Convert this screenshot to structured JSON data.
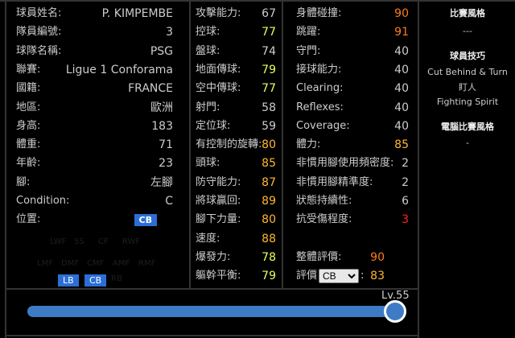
{
  "info": [
    {
      "label": "球員姓名:",
      "value": "P. KIMPEMBE"
    },
    {
      "label": "隊員編號:",
      "value": "3"
    },
    {
      "label": "球隊名稱:",
      "value": "PSG"
    },
    {
      "label": "聯賽:",
      "value": "Ligue 1 Conforama"
    },
    {
      "label": "國籍:",
      "value": "FRANCE"
    },
    {
      "label": "地區:",
      "value": "歐洲"
    },
    {
      "label": "身高:",
      "value": "183"
    },
    {
      "label": "體重:",
      "value": "71"
    },
    {
      "label": "年齡:",
      "value": "23"
    },
    {
      "label": "腳:",
      "value": "左腳"
    },
    {
      "label": "Condition:",
      "value": "C"
    },
    {
      "label": "位置:",
      "value": "CB"
    }
  ],
  "positions": {
    "row1": [
      "LWF",
      "SS",
      "CF",
      "RWF"
    ],
    "row2": [
      "LMF",
      "DMF",
      "CMF",
      "AMF",
      "RMF"
    ],
    "row3": [
      "LB",
      "CB",
      "RB"
    ]
  },
  "stats1": [
    {
      "label": "攻擊能力:",
      "value": "67",
      "color": "#cccccc"
    },
    {
      "label": "控球:",
      "value": "77",
      "color": "#e8ff5a"
    },
    {
      "label": "盤球:",
      "value": "74",
      "color": "#cccccc"
    },
    {
      "label": "地面傳球:",
      "value": "79",
      "color": "#e8ff5a"
    },
    {
      "label": "空中傳球:",
      "value": "77",
      "color": "#e8ff5a"
    },
    {
      "label": "射門:",
      "value": "58",
      "color": "#cccccc"
    },
    {
      "label": "定位球:",
      "value": "59",
      "color": "#cccccc"
    },
    {
      "label": "有控制的旋轉:",
      "value": "80",
      "color": "#ffb733"
    },
    {
      "label": "頭球:",
      "value": "85",
      "color": "#ffb733"
    },
    {
      "label": "防守能力:",
      "value": "87",
      "color": "#ffb733"
    },
    {
      "label": "將球贏回:",
      "value": "89",
      "color": "#ffb733"
    },
    {
      "label": "腳下力量:",
      "value": "80",
      "color": "#ffb733"
    },
    {
      "label": "速度:",
      "value": "88",
      "color": "#ffb733"
    },
    {
      "label": "爆發力:",
      "value": "78",
      "color": "#e8ff5a"
    },
    {
      "label": "軀幹平衡:",
      "value": "79",
      "color": "#e8ff5a"
    }
  ],
  "stats2": [
    {
      "label": "身體碰撞:",
      "value": "90",
      "color": "#ff7a1a"
    },
    {
      "label": "跳躍:",
      "value": "91",
      "color": "#ff7a1a"
    },
    {
      "label": "守門:",
      "value": "40",
      "color": "#cccccc"
    },
    {
      "label": "接球能力:",
      "value": "40",
      "color": "#cccccc"
    },
    {
      "label": "Clearing:",
      "value": "40",
      "color": "#cccccc"
    },
    {
      "label": "Reflexes:",
      "value": "40",
      "color": "#cccccc"
    },
    {
      "label": "Coverage:",
      "value": "40",
      "color": "#cccccc"
    },
    {
      "label": "體力:",
      "value": "85",
      "color": "#ffb733"
    },
    {
      "label": "非慣用腳使用頻密度:",
      "value": "2",
      "color": "#cccccc"
    },
    {
      "label": "非慣用腳精準度:",
      "value": "2",
      "color": "#cccccc"
    },
    {
      "label": "狀態持續性:",
      "value": "6",
      "color": "#cccccc"
    },
    {
      "label": "抗受傷程度:",
      "value": "3",
      "color": "#ff2020"
    }
  ],
  "overall": {
    "label": "整體評價:",
    "value": "90",
    "color": "#ff7a1a"
  },
  "rating": {
    "label": "評價",
    "select": "CB",
    "suffix": ":",
    "value": "83",
    "color": "#ffb733"
  },
  "side": {
    "style_title": "比賽風格",
    "style_value": "---",
    "skills_title": "球員技巧",
    "skills": [
      "Cut Behind & Turn",
      "盯人",
      "Fighting Spirit"
    ],
    "com_title": "電腦比賽風格",
    "com_value": "-"
  },
  "level": {
    "label": "Lv.55",
    "value": 55,
    "max": 55
  }
}
